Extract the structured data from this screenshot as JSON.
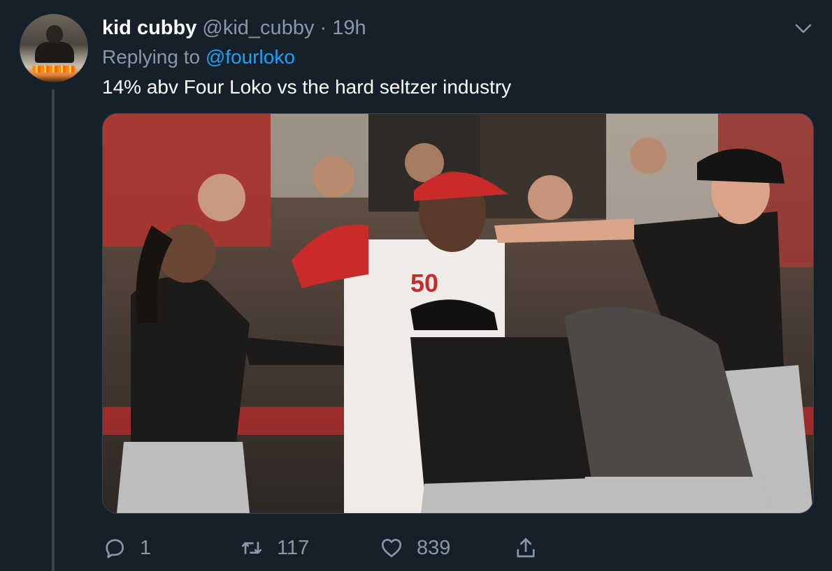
{
  "tweet": {
    "display_name": "kid cubby",
    "handle": "@kid_cubby",
    "separator": "·",
    "time": "19h",
    "replying_prefix": "Replying to",
    "replying_to": "@fourloko",
    "text": "14% abv Four Loko vs the hard seltzer industry",
    "media_alt": "Photo of a baseball brawl between Pittsburgh Pirates and Cincinnati Reds players",
    "stats": {
      "replies": "1",
      "retweets": "117",
      "likes": "839"
    }
  },
  "colors": {
    "background": "#15202b",
    "muted": "#8899a6",
    "link": "#1da1f2",
    "border": "#38444d"
  },
  "icons": {
    "avatar": "profile-avatar",
    "menu": "chevron-down-icon",
    "reply": "reply-icon",
    "retweet": "retweet-icon",
    "like": "heart-icon",
    "share": "share-icon"
  }
}
